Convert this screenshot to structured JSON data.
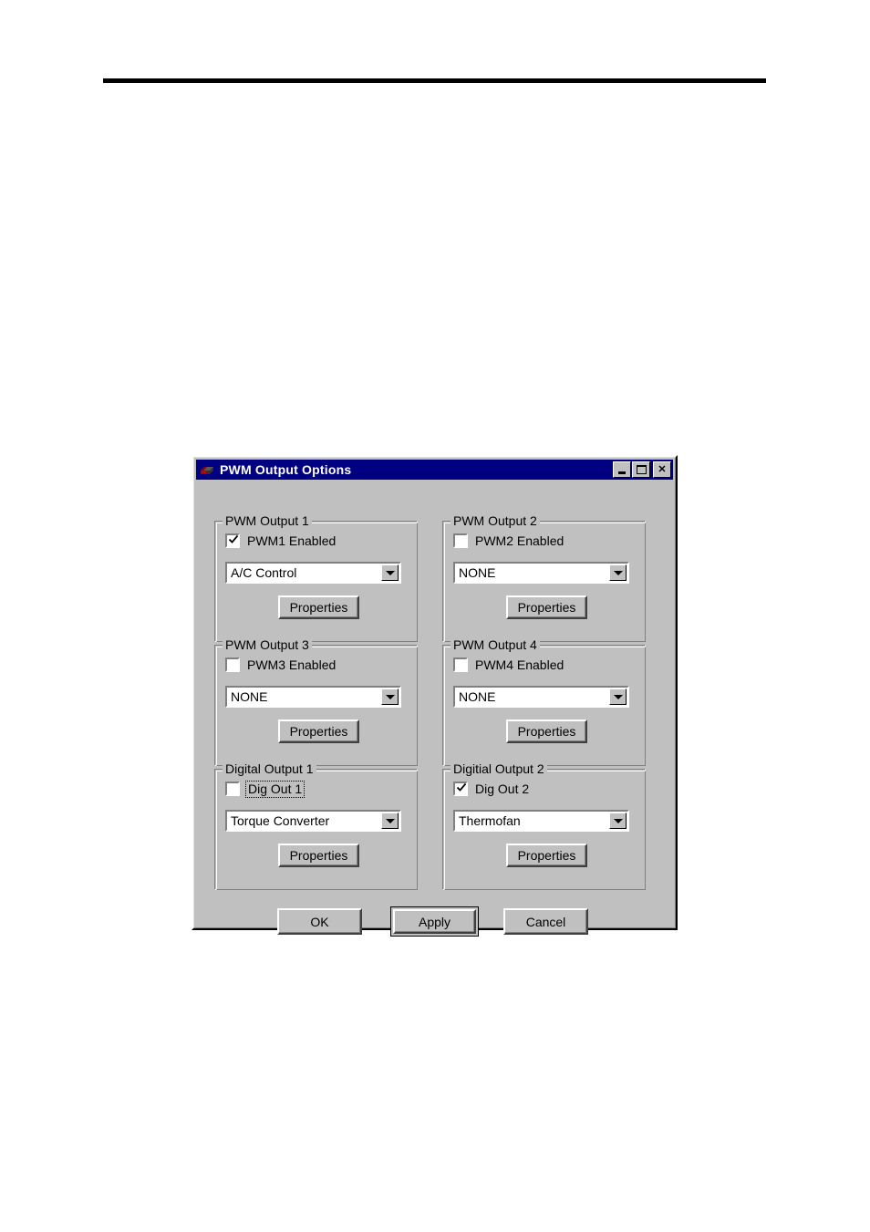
{
  "page": {
    "rule_color": "#000000"
  },
  "dialog": {
    "title": "PWM Output Options",
    "title_icon": "ecu-module-icon",
    "titlebar_color": "#000080",
    "face_color": "#c0c0c0",
    "window_buttons": [
      {
        "name": "minimize-button",
        "glyph": "_"
      },
      {
        "name": "maximize-button",
        "glyph": "□"
      },
      {
        "name": "close-button",
        "glyph": "✕"
      }
    ],
    "groups": [
      {
        "title": "PWM Output 1",
        "checkbox_label": "PWM1 Enabled",
        "checked": true,
        "focused": false,
        "combo_value": "A/C Control",
        "button_label": "Properties"
      },
      {
        "title": "PWM Output 2",
        "checkbox_label": "PWM2 Enabled",
        "checked": false,
        "focused": false,
        "combo_value": "NONE",
        "button_label": "Properties"
      },
      {
        "title": "PWM Output 3",
        "checkbox_label": "PWM3 Enabled",
        "checked": false,
        "focused": false,
        "combo_value": "NONE",
        "button_label": "Properties"
      },
      {
        "title": "PWM Output 4",
        "checkbox_label": "PWM4 Enabled",
        "checked": false,
        "focused": false,
        "combo_value": "NONE",
        "button_label": "Properties"
      },
      {
        "title": "Digital Output 1",
        "checkbox_label": "Dig Out 1",
        "checked": false,
        "focused": true,
        "combo_value": "Torque Converter",
        "button_label": "Properties"
      },
      {
        "title": "Digitial Output 2",
        "checkbox_label": "Dig Out 2",
        "checked": true,
        "focused": false,
        "combo_value": "Thermofan",
        "button_label": "Properties"
      }
    ],
    "footer_buttons": [
      {
        "name": "ok-button",
        "label": "OK",
        "is_default": false
      },
      {
        "name": "apply-button",
        "label": "Apply",
        "is_default": true
      },
      {
        "name": "cancel-button",
        "label": "Cancel",
        "is_default": false
      }
    ]
  }
}
